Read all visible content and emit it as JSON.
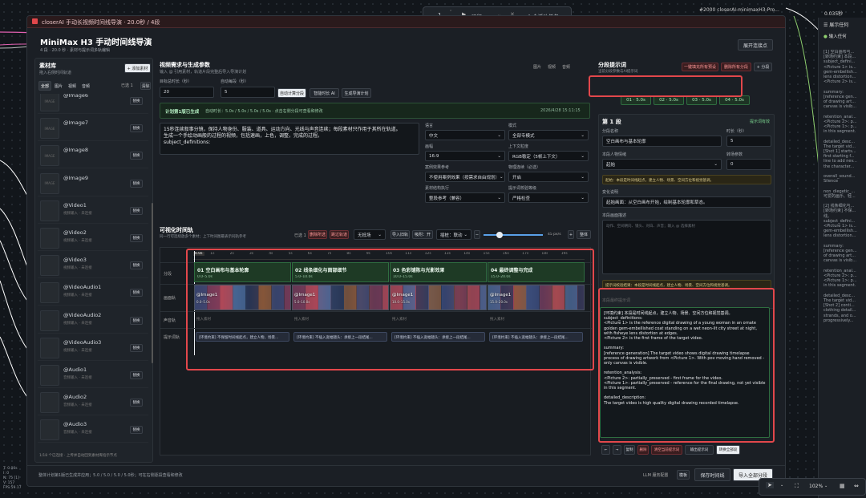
{
  "app": {
    "title": "closerAI 手动长视频时间线导演 · 20.0秒 / 4段",
    "run_count": "1",
    "run_label": "运行",
    "active_tasks": "0 个活动任务",
    "canvas_title": "#2000 closerAI-minimaxH3-Pro...",
    "zoom_badge": "0.035秒",
    "bg_labels": [
      "展示任何",
      "输入任何"
    ]
  },
  "header": {
    "title": "MiniMax H3 手动时间线导演",
    "subtitle": "4 段 · 20.0 秒 · 素材与提示词多轨编辑",
    "expand_btn": "展开连接点"
  },
  "library": {
    "title": "素材库",
    "desc": "拖入右侧时间轨道",
    "add_btn": "+ 添加素材",
    "tabs": [
      "全部",
      "图片",
      "视频",
      "音频"
    ],
    "count": "已选 1",
    "select_btn": "清除",
    "items": [
      {
        "name": "@Image6",
        "sub": "",
        "badge": "IMAGE",
        "act": "替换"
      },
      {
        "name": "@Image7",
        "sub": "",
        "badge": "IMAGE",
        "act": "替换"
      },
      {
        "name": "@Image8",
        "sub": "",
        "badge": "IMAGE",
        "act": "替换"
      },
      {
        "name": "@Image9",
        "sub": "",
        "badge": "IMAGE",
        "act": "替换"
      },
      {
        "name": "@Video1",
        "sub": "视频输入 · 未连接",
        "badge": "",
        "act": "替换"
      },
      {
        "name": "@Video2",
        "sub": "视频输入 · 未连接",
        "badge": "",
        "act": "替换"
      },
      {
        "name": "@Video3",
        "sub": "视频输入 · 未连接",
        "badge": "",
        "act": "替换"
      },
      {
        "name": "@VideoAudio1",
        "sub": "视频输入 · 未连接",
        "badge": "",
        "act": "替换"
      },
      {
        "name": "@VideoAudio2",
        "sub": "视频输入 · 未连接",
        "badge": "",
        "act": "替换"
      },
      {
        "name": "@VideoAudio3",
        "sub": "视频输入 · 未连接",
        "badge": "",
        "act": "替换"
      },
      {
        "name": "@Audio1",
        "sub": "音频输入 · 未连接",
        "badge": "",
        "act": "替换"
      },
      {
        "name": "@Audio2",
        "sub": "音频输入 · 未连接",
        "badge": "",
        "act": "替换"
      },
      {
        "name": "@Audio3",
        "sub": "音频输入 · 未连接",
        "badge": "",
        "act": "替换"
      }
    ],
    "footer": "1/18 个已连接 · 上传并自动回到素材库指示节点"
  },
  "params": {
    "title": "视频需求与生成参数",
    "desc": "输入 @ 引用素材，轨道片段完整后导入导演计划",
    "total_label": "目标总时长（秒）",
    "total_val": "20",
    "seg_label": "自动每段（秒）",
    "seg_val": "5",
    "auto_split_btn": "自动计算分段",
    "smart_btn": "智能时长 AI",
    "gen_btn": "生成导演计划",
    "check_labels": [
      "图片",
      "视频",
      "音频"
    ],
    "banner_title": "计划第1版已生成",
    "banner_text": "自动时长：5.0s / 5.0s / 5.0s / 5.0s · 点击右侧分段可查看和修改",
    "banner_time": "2026/4/28 15:11:15",
    "prompt_text": "15秒连续叙事分镜，保持人物身份、服装、道具、运动方向、光线与声音连续；每段素材只作用于其所在轨道。",
    "prompt_text2": "生成一个手绘动画般的过程的视频，包括速画，上色，调整，完成的过程。",
    "prompt_text3": "subject_definitions:",
    "opt_labels": [
      "语言",
      "模式",
      "画幅",
      "上下文粒度",
      "案例效果参考",
      "物理连续（必选）",
      "素材结构执行",
      "提示词校验等级"
    ],
    "opt_vals": [
      "中文",
      "全部专模式",
      "16:9",
      "RGB稳定（5帧上下文）",
      "不使用案例效果（按需求自由规划）",
      "开启",
      "整段参考（兼容）",
      "严格检查"
    ]
  },
  "timeline": {
    "title": "可视化时间轨",
    "desc": "同一行可连续放多个素材；上下时间图最表示同轨参考",
    "count": "已选 1",
    "del_btn": "删除所选",
    "copy_btn": "跳过轨道",
    "mode_select": "无抵场",
    "import_btn": "导入旧轨",
    "snap_label": "吸附：开",
    "gap_label": "插桩：联动",
    "zoom_label": "45 px/s",
    "fit_btn": "整体",
    "track_labels": [
      "分段",
      "画面轨",
      "声音轨",
      "提示词轨"
    ],
    "ticks": [
      "0.0s",
      "1s",
      "2s",
      "3s",
      "4s",
      "5s",
      "6s",
      "7s",
      "8s",
      "9s",
      "10s",
      "11s",
      "12s",
      "13s",
      "14s",
      "15s",
      "16s",
      "17s",
      "18s",
      "19s"
    ],
    "segments": [
      {
        "title": "01 空白画布与基本轮廓",
        "time": "0.0–5.0s"
      },
      {
        "title": "02 线条细化与面部细节",
        "time": "5.0–10.0s"
      },
      {
        "title": "03 色彩铺陈与光影效果",
        "time": "10.0–15.0s"
      },
      {
        "title": "04 最终调整与完成",
        "time": "15.0–20.0s"
      }
    ],
    "clips": [
      {
        "name": "@Image1",
        "time": "0.0–5.0s"
      },
      {
        "name": "@Image1",
        "time": "5.0–10.0s"
      },
      {
        "name": "@Image1",
        "time": "10.0–15.0s"
      },
      {
        "name": "@Image1",
        "time": "15.0–20.0s"
      }
    ],
    "audio_placeholder": "拖入素材",
    "prompt_clips": [
      "[环境约束] 不保留时间线起点，建立人物，场景...",
      "[环境约束] 不插入宽幅镜头：承接上一段结尾...",
      "[环境约束] 不插入宽幅镜头：承接上一段结尾...",
      "[环境约束] 不插入宽幅镜头：承接上一段结尾..."
    ]
  },
  "status": {
    "text": "整体计划第1版已生成并应用；5.0 / 5.0 / 5.0 / 5.0秒；可在右侧逐段查看和修改",
    "llm": "LLM 服务配置",
    "llm_btn": "模板",
    "save_btn": "保存时间线",
    "import_btn": "导入全部分段"
  },
  "seg_prompt": {
    "title": "分段提示词",
    "desc": "当前分段参数与AI提示词",
    "fill_btn": "一键填充所有预设",
    "del_btn": "删除所有分段",
    "add_btn": "+ 分段",
    "chips": [
      "01 · 5.0s",
      "02 · 5.0s",
      "03 · 5.0s",
      "04 · 5.0s"
    ],
    "seg_title": "第 1 段",
    "seg_link": "提示词有效",
    "name_label": "分段名称",
    "name_val": "空白画布与基本轮廓",
    "dur_label": "时长（秒）",
    "dur_val": "5",
    "scene_label": "本段人物情绪",
    "scene_val": "起始",
    "trans_label": "转场参数",
    "trans_val": "0",
    "note1": "起始：本段是时间线起点，建立人物、场景、空间方位和视觉基调。",
    "change_label": "变化说明",
    "change_val": "起始画面：从空白画布开始，绘制基本轮廓和草态。",
    "reason_label": "本段画面描述",
    "reason_placeholder": "动作、空间朝向、镜头、对白、声音；输入 @ 选择素材",
    "note2": "提示词校验结果：本段是时间线起点，建立人物、场景、空间方位和视觉基调。",
    "sent_label": "本段最终提示词",
    "final_prompt": [
      "[环境约束] 本段是时间线起点，建立人物、场景、空间方位和视觉基调。",
      "subject_definitions:",
      "<Picture 1> is the reference digital drawing of a young woman in an ornate golden gem-embellished coat standing on a wet neon-lit city street at night, with fisheye lens distortion at edges.",
      "<Picture 2> is the first frame of the target video.",
      "",
      "summary:",
      "[reference generation] The target video shows digital drawing timelapse process of drawing artwork from <Picture 1>. With pov moving hand removed - only canvas is visible.",
      "",
      "retention_analysis:",
      "<Picture 2>: partially_preserved - first frame for the video.",
      "<Picture 1>: partially_preserved - reference for the final drawing, not yet visible in this segment.",
      "",
      "detailed_description:",
      "The target video is high quality digital drawing recorded timelapse."
    ],
    "footer_btns": [
      "←",
      "→",
      "复制",
      "删除",
      "清空当前提示词",
      "输出提示词",
      "转换全部段"
    ]
  },
  "right_panel": {
    "title": "展示任何",
    "lines": [
      "[1] 空白画布与...",
      "[转场约束] 本段...",
      "subject_defini...",
      "<Picture 1> is...",
      "gem-embellish...",
      "lens distortion...",
      "<Picture 2> is...",
      "",
      "summary:",
      "[reference gen...",
      "of drawing art...",
      "canvas is visib...",
      "",
      "retention_anal...",
      "<Picture 2>: p...",
      "<Picture 1>: p...",
      "in this segment.",
      "",
      "detailed_desc...",
      "The target vid...",
      "[Shot 1] starts...",
      "first starting f...",
      "line to add nev...",
      "the character...",
      "",
      "overall_sound...",
      "Silence",
      "",
      "non_diegetic_...",
      "可爱的画乐、轻...",
      "",
      "[2] 线条细化与...",
      "[转场约束] 不保...",
      "线。",
      "subject_defini...",
      "<Picture 1> is...",
      "gem-embellish...",
      "lens distortion...",
      "",
      "summary:",
      "[reference gen...",
      "of drawing art...",
      "canvas is visib...",
      "",
      "retention_anal...",
      "<Picture 2>: p...",
      "<Picture 1>: p...",
      "in this segment.",
      "",
      "detailed_desc...",
      "The target vid...",
      "[Shot 2] conti...",
      "clothing detail...",
      "strands, and o...",
      "progressively..."
    ]
  },
  "bottom": {
    "zoom": "102%",
    "stats": [
      "T: 0.00s",
      "I: 0",
      "N: 75 [1]",
      "V: 157",
      "FPS:59.17"
    ]
  }
}
